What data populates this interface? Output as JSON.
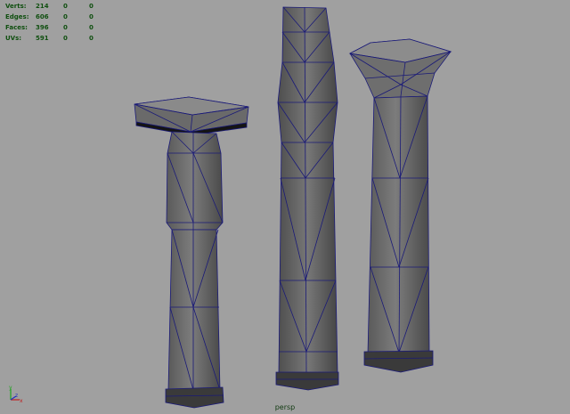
{
  "heads_up_display": {
    "rows": [
      {
        "label": "Verts:",
        "v1": "214",
        "v2": "0",
        "v3": "0"
      },
      {
        "label": "Edges:",
        "v1": "606",
        "v2": "0",
        "v3": "0"
      },
      {
        "label": "Faces:",
        "v1": "396",
        "v2": "0",
        "v3": "0"
      },
      {
        "label": "UVs:",
        "v1": "591",
        "v2": "0",
        "v3": "0"
      }
    ]
  },
  "viewport": {
    "camera_label": "persp",
    "background_color": "#a0a0a0",
    "wireframe_color": "#1a1a78",
    "axis_labels": {
      "y": "y",
      "x": "x",
      "z": "z"
    }
  }
}
